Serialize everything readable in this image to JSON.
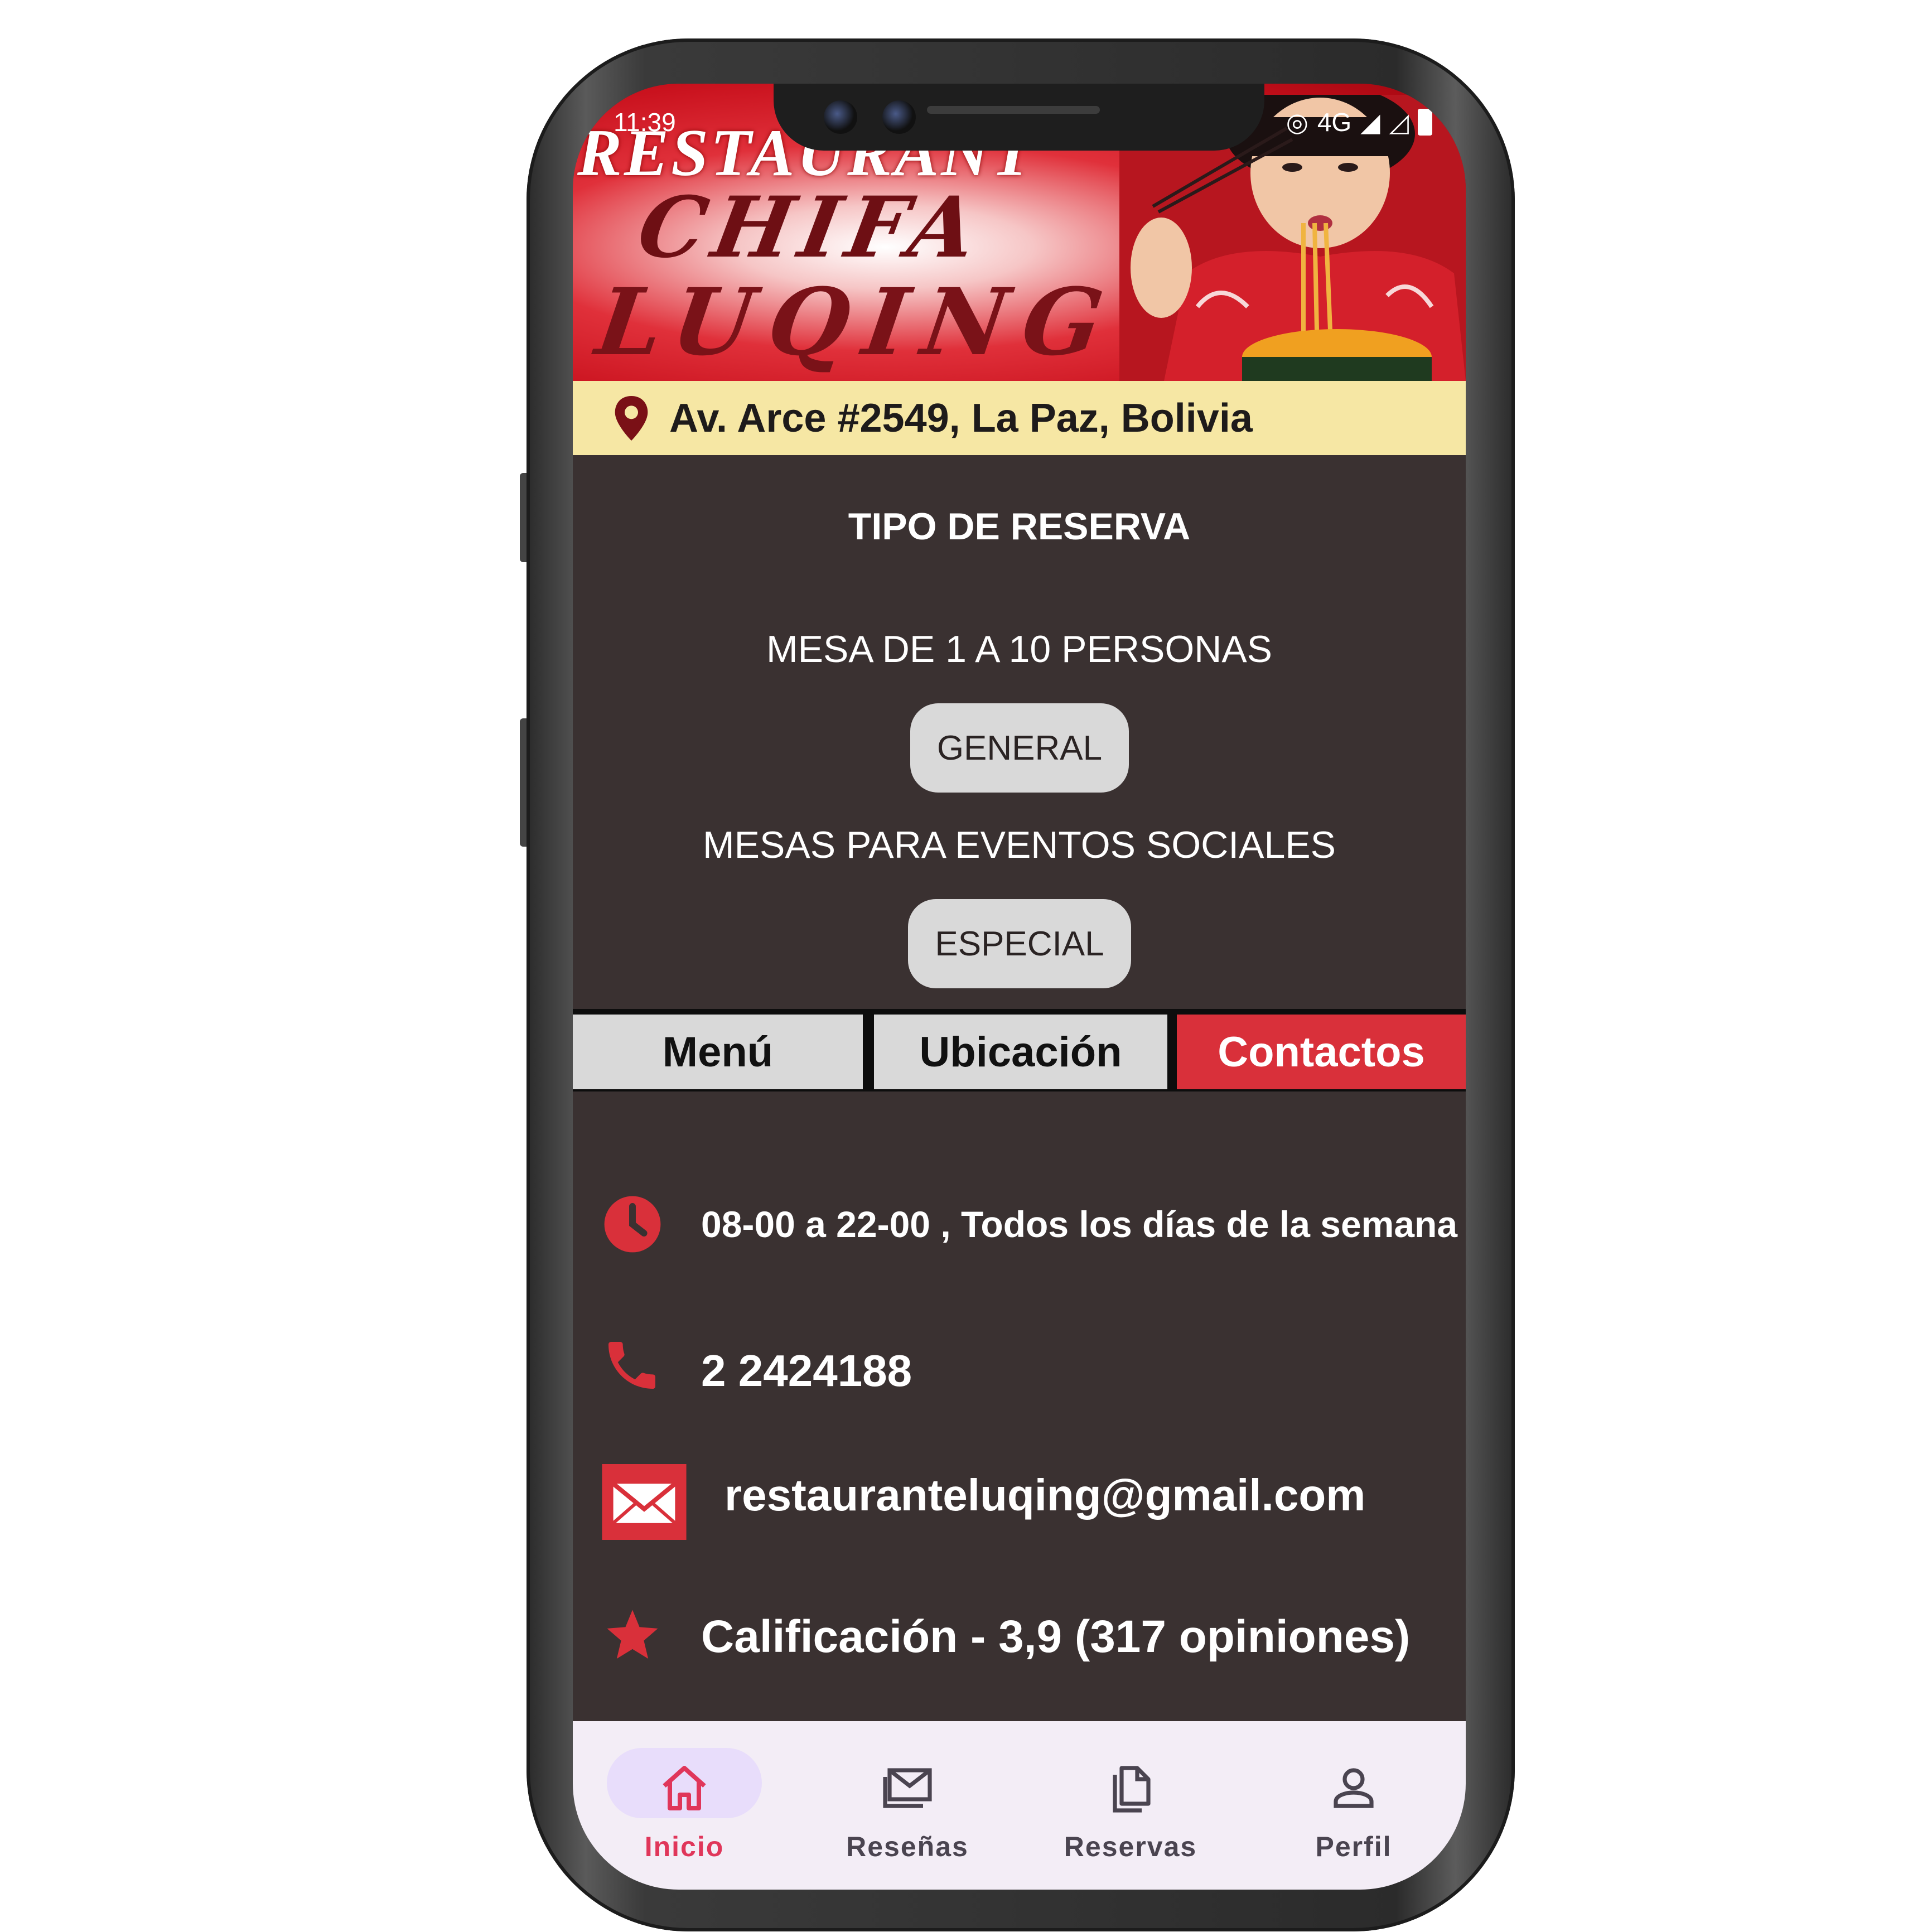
{
  "status_bar": {
    "time": "11:39",
    "network": "4G"
  },
  "banner": {
    "word1": "RESTAURANT",
    "word2": "CHIFA",
    "word3": "LUQING",
    "image": "girl-eating-noodles-photo"
  },
  "address": {
    "icon": "location-pin-icon",
    "text": "Av. Arce #2549, La Paz, Bolivia"
  },
  "reservation": {
    "title": "TIPO DE RESERVA",
    "general_desc": "MESA DE 1 A 10 PERSONAS",
    "general_button": "GENERAL",
    "special_desc": "MESAS PARA EVENTOS SOCIALES",
    "special_button": "ESPECIAL"
  },
  "tabs": [
    {
      "label": "Menú",
      "active": false
    },
    {
      "label": "Ubicación",
      "active": false
    },
    {
      "label": "Contactos",
      "active": true
    }
  ],
  "contacts": {
    "hours": "08-00 a 22-00 , Todos los días de la semana",
    "phone": "2 2424188",
    "email": "restauranteluqing@gmail.com",
    "rating": "Calificación - 3,9 (317 opiniones)"
  },
  "bottom_nav": [
    {
      "label": "Inicio",
      "icon": "home-icon",
      "active": true
    },
    {
      "label": "Reseñas",
      "icon": "mail-icon",
      "active": false
    },
    {
      "label": "Reservas",
      "icon": "document-icon",
      "active": false
    },
    {
      "label": "Perfil",
      "icon": "person-icon",
      "active": false
    }
  ],
  "colors": {
    "accent": "#d9303a",
    "background": "#3a3131",
    "address_bg": "#f6e7a4",
    "nav_active": "#e0365a"
  }
}
